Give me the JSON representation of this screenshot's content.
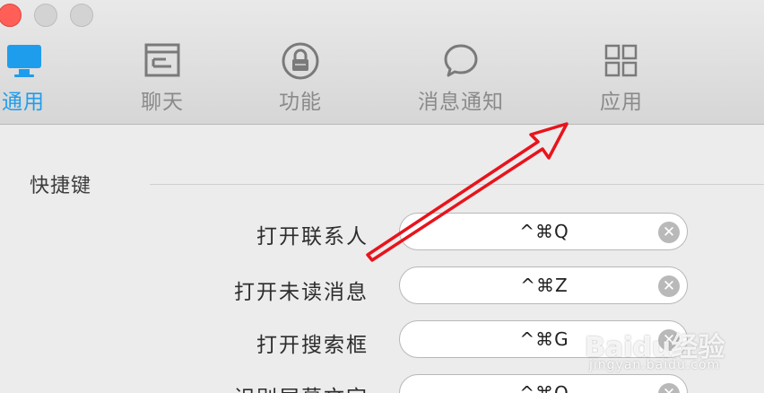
{
  "window": {
    "traffic_lights": [
      "close",
      "minimize",
      "zoom"
    ]
  },
  "toolbar": {
    "tabs": [
      {
        "label": "通用",
        "icon": "monitor-icon",
        "active": true
      },
      {
        "label": "聊天",
        "icon": "chat-window-icon",
        "active": false
      },
      {
        "label": "功能",
        "icon": "lock-icon",
        "active": false
      },
      {
        "label": "消息通知",
        "icon": "speech-bubble-icon",
        "active": false
      },
      {
        "label": "应用",
        "icon": "app-grid-icon",
        "active": false
      }
    ],
    "active_color": "#1f9ded",
    "inactive_color": "#8a8a8a"
  },
  "shortcuts": {
    "section_title": "快捷键",
    "rows": [
      {
        "label": "打开联系人",
        "value": "^⌘Q"
      },
      {
        "label": "打开未读消息",
        "value": "^⌘Z"
      },
      {
        "label": "打开搜索框",
        "value": "^⌘G"
      },
      {
        "label": "识别屏幕文字",
        "value": "^⌘O"
      }
    ]
  },
  "annotation": {
    "arrow_color": "#e8141c"
  },
  "watermark": {
    "text": "Baidu经验",
    "sub": "jingyan.baidu.com"
  }
}
